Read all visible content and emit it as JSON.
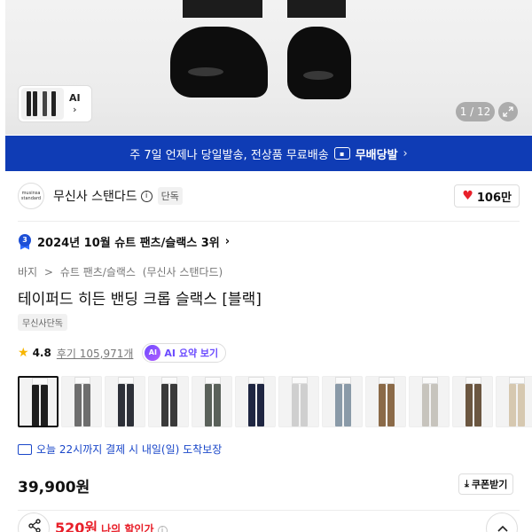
{
  "gallery": {
    "pager": "1 / 12",
    "thumb_ai_label": "AI"
  },
  "banner": {
    "text": "주 7일 언제나 당일발송, 전상품 무료배송",
    "brand": "무배당발",
    "badge_icon": "truck-icon",
    "color": "#0f3cb5"
  },
  "brand": {
    "logo_line1": "musinsa",
    "logo_line2": "standard",
    "name": "무신사 스탠다드",
    "tag": "단독",
    "likes": "106만"
  },
  "ranking": {
    "text": "2024년 10월 슈트 팬츠/슬랙스 3위",
    "medal_number": "3"
  },
  "product": {
    "breadcrumb": [
      "바지",
      ">",
      "슈트 팬츠/슬랙스",
      "(무신사 스탠다드)"
    ],
    "title": "테이퍼드 히든 밴딩 크롭 슬랙스 [블랙]",
    "exclusive_tag": "무신사단독",
    "rating": "4.8",
    "reviews": "후기 105,971개",
    "ai_summary_chip": "AI",
    "ai_summary": "AI 요약 보기",
    "swatch_colors": [
      "#1e1e1e",
      "#6e6e6e",
      "#2d3038",
      "#3a3a3a",
      "#5a615a",
      "#1f2642",
      "#cfcfcf",
      "#8a9aa8",
      "#8b6a48",
      "#c7c4bd",
      "#6b5640",
      "#d6c8b0"
    ],
    "selected_swatch": 0,
    "delivery": "오늘 22시까지 결제 시 내일(일) 도착보장",
    "price": "39,900원",
    "coupon": "쿠폰받기"
  },
  "bottom": {
    "discount_amount": "520원",
    "discount_label": "나의 할인가",
    "info": "i"
  },
  "colors": {
    "accent_blue": "#1a47c9",
    "sale_red": "#e8202a",
    "rating_star": "#f7b500"
  }
}
